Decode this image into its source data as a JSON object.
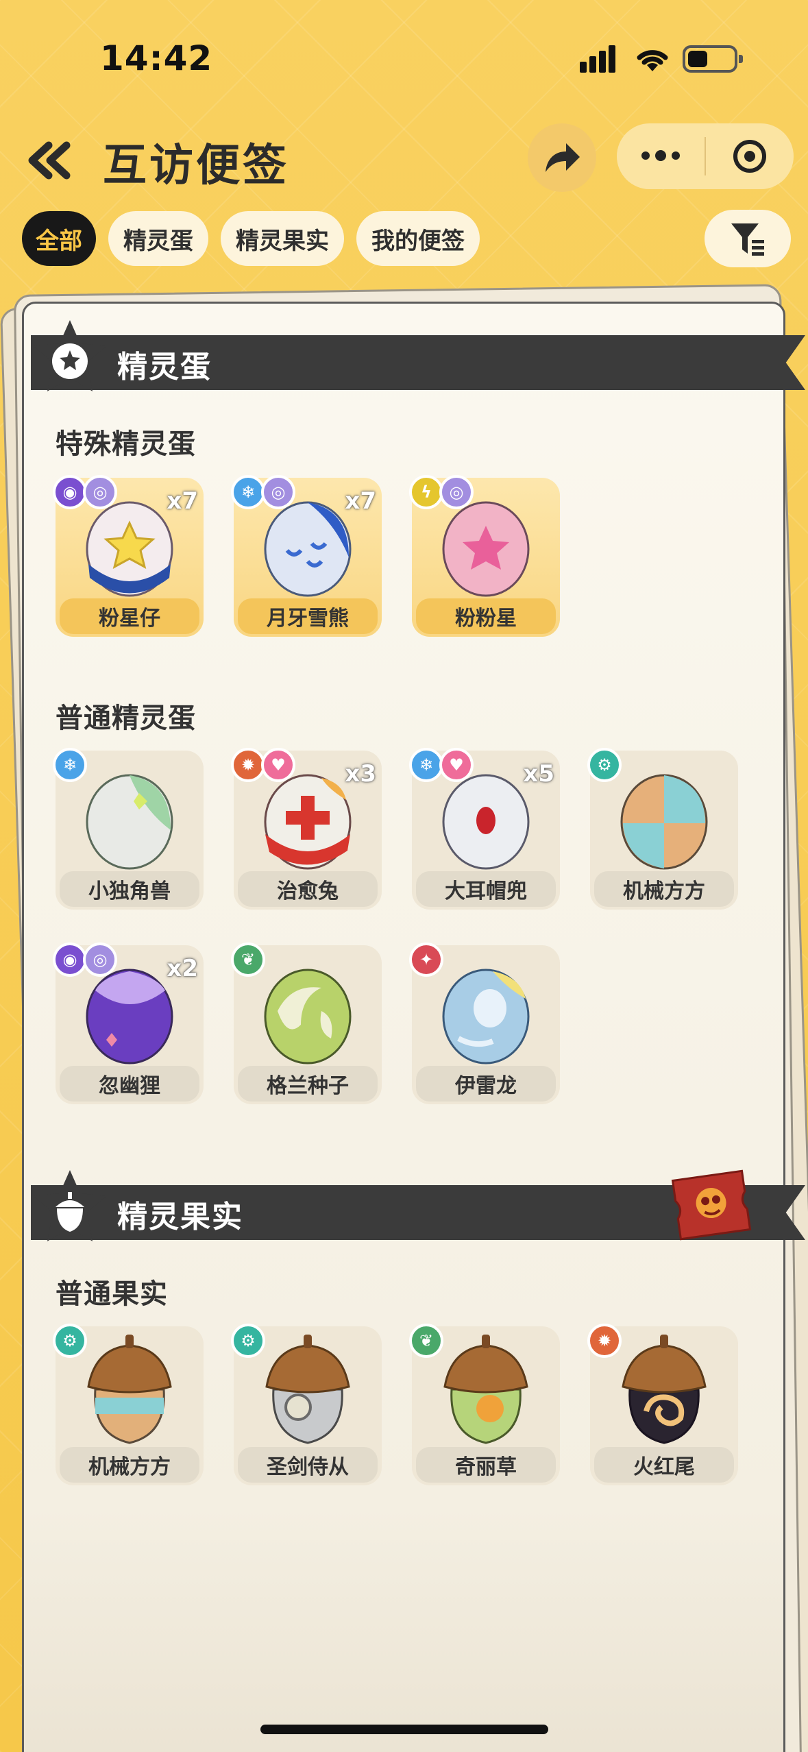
{
  "status_bar": {
    "time": "14:42"
  },
  "header": {
    "title": "互访便签"
  },
  "tabs": [
    {
      "label": "全部",
      "active": true
    },
    {
      "label": "精灵蛋",
      "active": false
    },
    {
      "label": "精灵果实",
      "active": false
    },
    {
      "label": "我的便签",
      "active": false
    }
  ],
  "sections": {
    "eggs": {
      "title": "精灵蛋",
      "special": {
        "heading": "特殊精灵蛋",
        "items": [
          {
            "name": "粉星仔",
            "qty": "x7",
            "types": [
              "ghost-icon",
              "spiral-icon"
            ]
          },
          {
            "name": "月牙雪熊",
            "qty": "x7",
            "types": [
              "ice-icon",
              "spiral-icon"
            ]
          },
          {
            "name": "粉粉星",
            "qty": "",
            "types": [
              "bolt-icon",
              "spiral-icon"
            ]
          }
        ]
      },
      "normal": {
        "heading": "普通精灵蛋",
        "items": [
          {
            "name": "小独角兽",
            "qty": "",
            "types": [
              "ice-icon"
            ]
          },
          {
            "name": "治愈兔",
            "qty": "x3",
            "types": [
              "fire-icon",
              "heart-icon"
            ]
          },
          {
            "name": "大耳帽兜",
            "qty": "x5",
            "types": [
              "ice-icon",
              "heart-icon"
            ]
          },
          {
            "name": "机械方方",
            "qty": "",
            "types": [
              "gear-icon"
            ]
          },
          {
            "name": "忽幽狸",
            "qty": "x2",
            "types": [
              "ghost-icon",
              "spiral-icon"
            ]
          },
          {
            "name": "格兰种子",
            "qty": "",
            "types": [
              "leaf-icon"
            ]
          },
          {
            "name": "伊雷龙",
            "qty": "",
            "types": [
              "fang-icon"
            ]
          }
        ]
      }
    },
    "fruits": {
      "title": "精灵果实",
      "normal": {
        "heading": "普通果实",
        "items": [
          {
            "name": "机械方方",
            "types": [
              "gear-icon"
            ]
          },
          {
            "name": "圣剑侍从",
            "types": [
              "gear-icon"
            ]
          },
          {
            "name": "奇丽草",
            "types": [
              "leaf-icon"
            ]
          },
          {
            "name": "火红尾",
            "types": [
              "fire-icon"
            ]
          }
        ]
      }
    }
  },
  "colors": {
    "background": "#f8cd55",
    "tab_active_bg": "#181818",
    "tab_active_text": "#f9c646",
    "banner": "#3b3b3b"
  }
}
